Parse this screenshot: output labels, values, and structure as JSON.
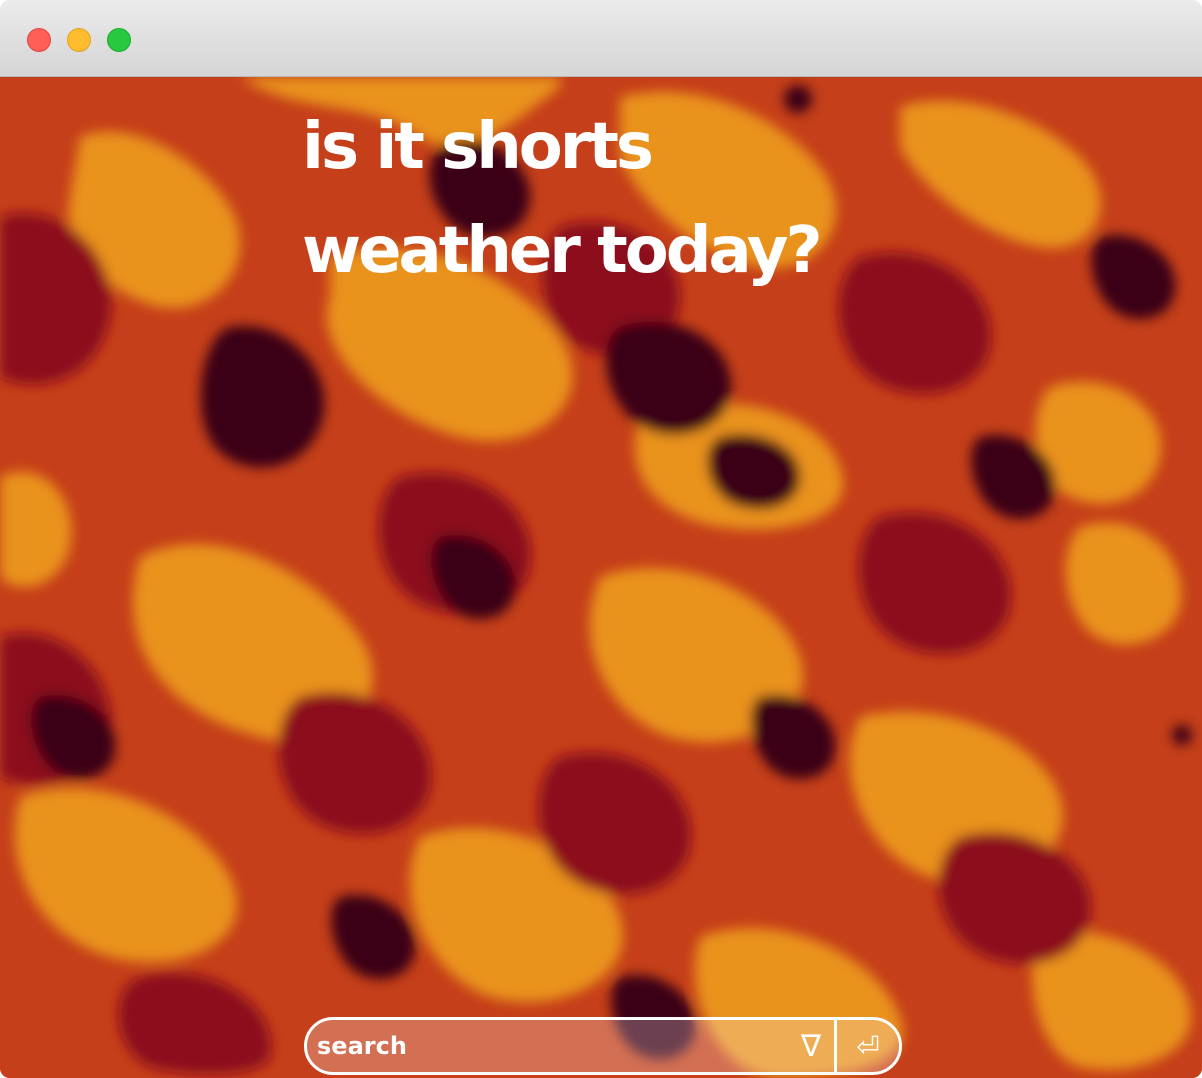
{
  "window": {
    "controls": [
      "close-button",
      "minimize-button",
      "maximize-button"
    ]
  },
  "headline": {
    "line1": "is it shorts",
    "line2": "weather today?"
  },
  "search": {
    "placeholder": "search",
    "value": "",
    "dropdown_icon": "∇",
    "enter_icon": "⏎"
  },
  "colors": {
    "bg_dark": "#3a0012",
    "bg_crimson": "#8c0b1a",
    "bg_orange": "#c53f1a",
    "bg_amber": "#e9921a",
    "text": "#ffffff",
    "close": "#ff5f57",
    "minimize": "#febc2e",
    "maximize": "#28c840"
  }
}
